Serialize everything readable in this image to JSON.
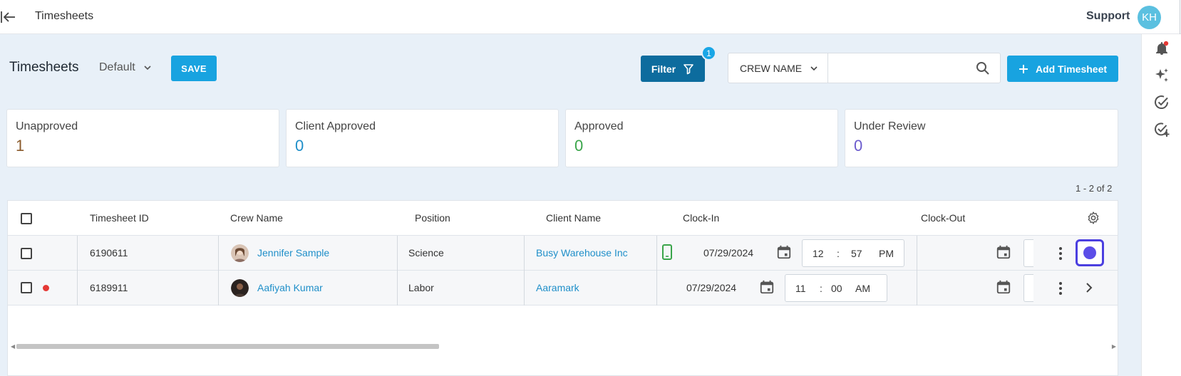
{
  "topbar": {
    "title": "Timesheets",
    "support_label": "Support",
    "avatar_initials": "KH"
  },
  "header": {
    "page_title": "Timesheets",
    "view_label": "Default",
    "save_label": "SAVE",
    "filter_label": "Filter",
    "filter_count": "1",
    "crew_select_label": "CREW NAME",
    "search_placeholder": "",
    "add_label": "Add Timesheet"
  },
  "stats": [
    {
      "label": "Unapproved",
      "value": "1",
      "color": "#8a5a2b"
    },
    {
      "label": "Client Approved",
      "value": "0",
      "color": "#1f8fc9"
    },
    {
      "label": "Approved",
      "value": "0",
      "color": "#3aa54a"
    },
    {
      "label": "Under Review",
      "value": "0",
      "color": "#6a5acd"
    }
  ],
  "pager": "1 - 2 of 2",
  "table": {
    "columns": {
      "id": "Timesheet ID",
      "crew": "Crew Name",
      "position": "Position",
      "client": "Client Name",
      "clock_in": "Clock-In",
      "clock_out": "Clock-Out"
    },
    "rows": [
      {
        "id": "6190611",
        "crew": "Jennifer Sample",
        "position": "Science",
        "client": "Busy Warehouse Inc",
        "date": "07/29/2024",
        "hour": "12",
        "minute": "57",
        "ampm": "PM",
        "flag": false,
        "mobile": true
      },
      {
        "id": "6189911",
        "crew": "Aafiyah Kumar",
        "position": "Labor",
        "client": "Aaramark",
        "date": "07/29/2024",
        "hour": "11",
        "minute": "00",
        "ampm": "AM",
        "flag": true,
        "mobile": false
      }
    ]
  },
  "colors": {
    "primary": "#18a3e0",
    "filter": "#0d6c9e",
    "link": "#1f8fc9",
    "background": "#e8f0f8",
    "focus": "#4b3fe0",
    "alert": "#e53935",
    "mobile": "#3aa54a"
  },
  "icons": {
    "back": "back-arrow-icon",
    "bell": "bell-icon",
    "sparkle": "sparkle-icon",
    "check": "check-circle-icon",
    "check_plus": "check-circle-plus-icon",
    "search": "search-icon",
    "filter": "filter-icon",
    "settings": "gear-icon",
    "calendar": "calendar-icon",
    "more": "kebab-menu-icon",
    "next": "chevron-right-icon",
    "mobile": "mobile-phone-icon"
  }
}
